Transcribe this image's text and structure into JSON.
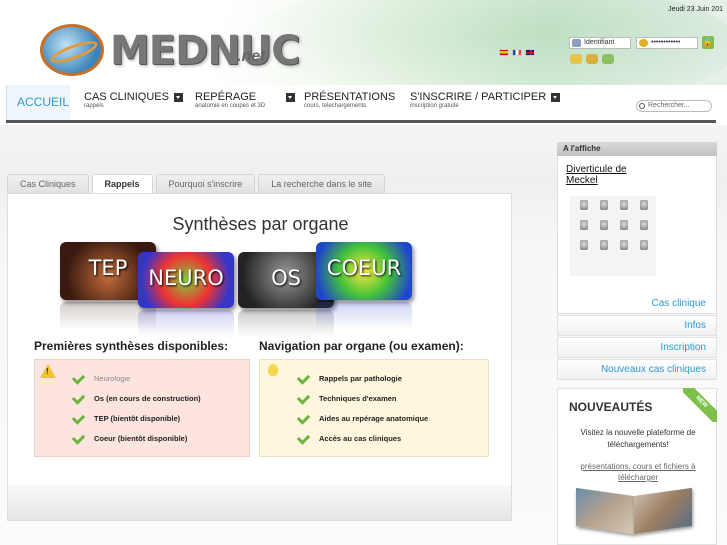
{
  "header": {
    "date": "Jeudi 23 Juin 201",
    "logo_text": "MEDNUC",
    "logo_suffix": ".net",
    "languages": [
      "es",
      "fr",
      "en"
    ],
    "login": {
      "username_placeholder": "Identifiant",
      "password_value": "••••••••••••"
    }
  },
  "nav": {
    "home": "ACCUEIL",
    "items": [
      {
        "title": "CAS CLINIQUES",
        "sub": "rappels"
      },
      {
        "title": "REPÉRAGE",
        "sub": "anatomie en coupes et 3D"
      },
      {
        "title": "PRÉSENTATIONS",
        "sub": "cours, telechargements"
      },
      {
        "title": "S'INSCRIRE / PARTICIPER",
        "sub": "inscription gratuite"
      }
    ],
    "search_placeholder": "Rechercher..."
  },
  "main": {
    "tabs": [
      "Cas Cliniques",
      "Rappels",
      "Pourquoi s'inscrire",
      "La recherche dans le site"
    ],
    "heading": "Synthèses par organe",
    "organs": [
      "TEP",
      "NEURO",
      "OS",
      "COEUR"
    ],
    "left_col": {
      "heading": "Premières synthèses disponibles:",
      "items": [
        "Neurologie",
        "Os (en cours de construction)",
        "TEP (bientôt disponible)",
        "Coeur (bientôt disponible)"
      ]
    },
    "right_col": {
      "heading": "Navigation par organe (ou examen):",
      "items": [
        "Rappels par pathologie",
        "Techniques d'examen",
        "Aides au repérage anatomique",
        "Accès au cas cliniques"
      ]
    }
  },
  "sidebar": {
    "affiche_title": "A l'affiche",
    "case_title": "Diverticule de Meckel",
    "case_link": "Cas clinique",
    "links": [
      "Infos",
      "Inscription",
      "Nouveaux cas cliniques"
    ],
    "news": {
      "heading": "NOUVEAUTÉS",
      "badge": "NEW",
      "text": "Visitez la nouvelle plateforme de téléchargements!",
      "link": "présentations, cours et fichiers à télécharger"
    }
  },
  "colors": {
    "accent": "#2a9bd0",
    "check": "#6db33f",
    "nav_rule": "#555555"
  }
}
